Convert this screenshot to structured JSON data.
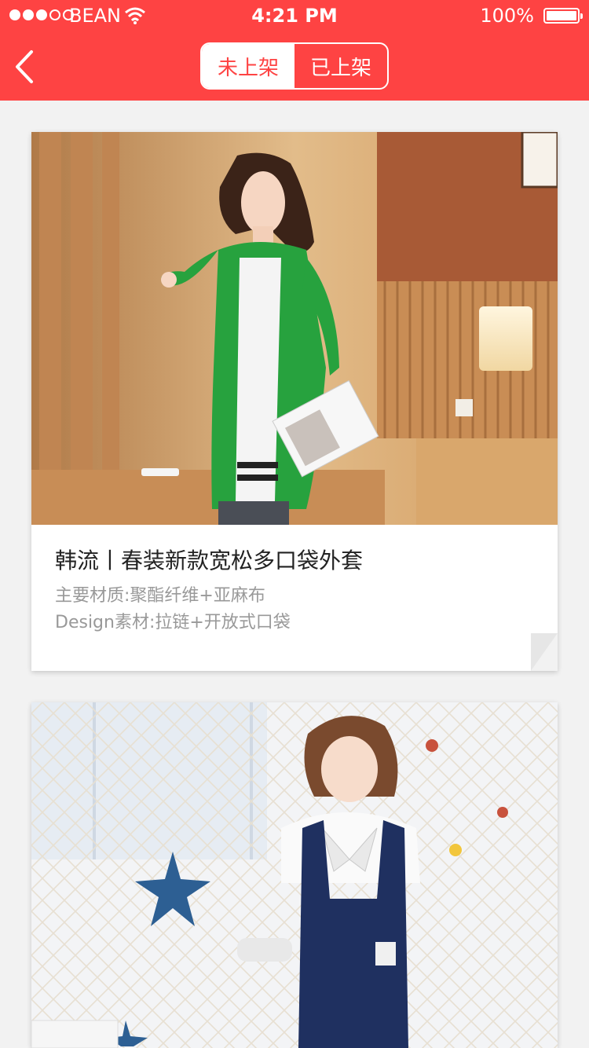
{
  "status_bar": {
    "carrier": "BEAN",
    "time": "4:21 PM",
    "battery": "100%"
  },
  "nav": {
    "tabs": [
      {
        "label": "未上架"
      },
      {
        "label": "已上架"
      }
    ]
  },
  "products": [
    {
      "title": "韩流丨春装新款宽松多口袋外套",
      "material": "主要材质:聚酯纤维+亚麻布",
      "design": "Design素材:拉链+开放式口袋"
    }
  ],
  "colors": {
    "brand": "#fe4343",
    "background": "#f2f2f2",
    "title_text": "#222222",
    "sub_text": "#999999"
  },
  "icons": [
    "back-chevron-icon",
    "wifi-icon",
    "battery-icon",
    "signal-dots-icon"
  ]
}
